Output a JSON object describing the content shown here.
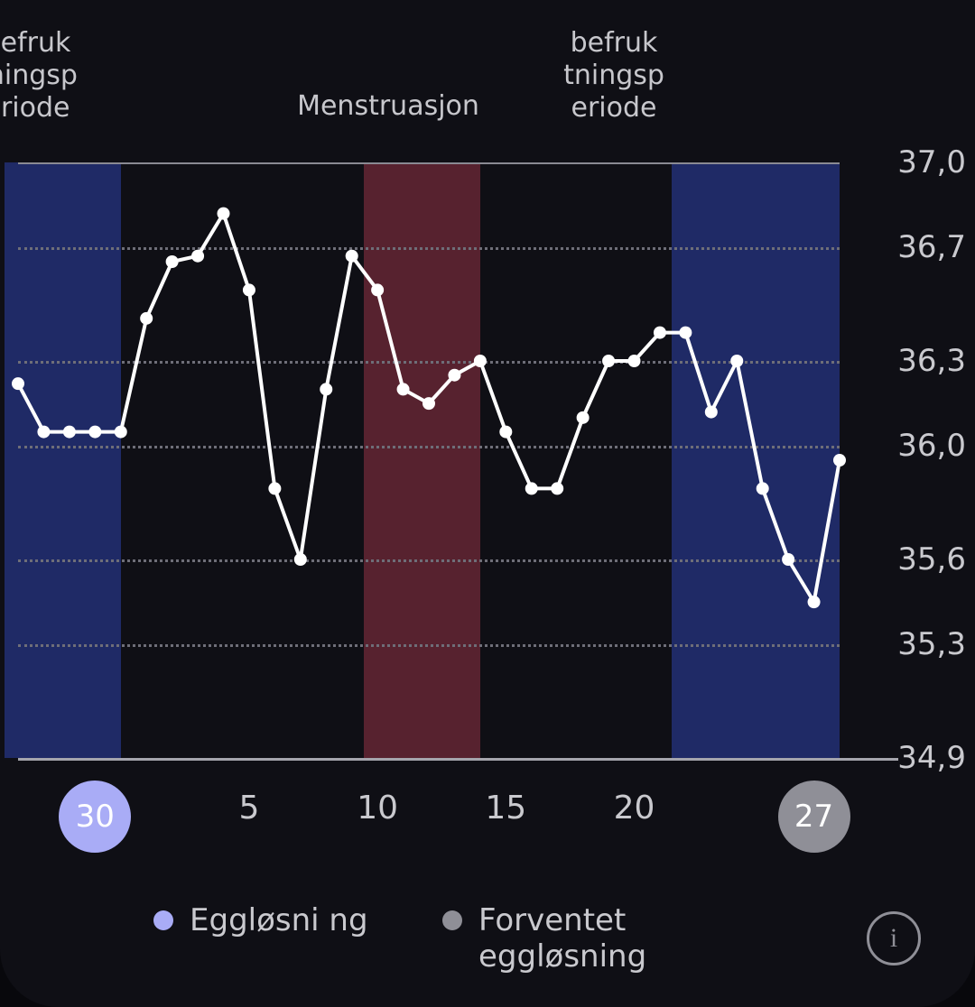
{
  "colors": {
    "fertile_band": "#1f2a66",
    "menstruation_band": "#57222f",
    "ovulation_badge": "#a9acf6",
    "expected_badge": "#8f8f97",
    "line": "#ffffff"
  },
  "phases": [
    {
      "label": "befruk\ntningsp\neriode"
    },
    {
      "label": "Menstruasjon"
    },
    {
      "label": "befruk\ntningsp\neriode"
    }
  ],
  "legend": [
    {
      "label": "Eggløsni\nng",
      "kind": "ovulation"
    },
    {
      "label": "Forventet eggløsning",
      "kind": "expected"
    }
  ],
  "chart_data": {
    "type": "line",
    "title": "",
    "xlabel": "",
    "ylabel": "",
    "ylim": [
      34.9,
      37.0
    ],
    "y_ticks": [
      34.9,
      35.3,
      35.6,
      36.0,
      36.3,
      36.7,
      37.0
    ],
    "y_tick_labels": [
      "34,9",
      "35,3",
      "35,6",
      "36,0",
      "36,3",
      "36,7",
      "37,0"
    ],
    "x_range": [
      27,
      30
    ],
    "x_ticks_plain": [
      5,
      10,
      15,
      20
    ],
    "x_badges": [
      {
        "x": 30,
        "label": "30",
        "kind": "ovulation"
      },
      {
        "x": 27,
        "label": "27",
        "kind": "expected",
        "wrap": true
      }
    ],
    "bands": [
      {
        "from": 27,
        "to": 31,
        "kind": "fertile"
      },
      {
        "from": 10,
        "to": 14,
        "kind": "menstruation"
      },
      {
        "from": 22,
        "to": 28,
        "kind": "fertile",
        "wrap": true
      }
    ],
    "series": [
      {
        "name": "temperature",
        "points": [
          {
            "x": 27,
            "y": 36.22
          },
          {
            "x": 28,
            "y": 36.05
          },
          {
            "x": 29,
            "y": 36.05
          },
          {
            "x": 30,
            "y": 36.05
          },
          {
            "x": 31,
            "y": 36.05
          },
          {
            "x": 1,
            "y": 36.45
          },
          {
            "x": 2,
            "y": 36.65
          },
          {
            "x": 3,
            "y": 36.67
          },
          {
            "x": 4,
            "y": 36.82
          },
          {
            "x": 5,
            "y": 36.55
          },
          {
            "x": 6,
            "y": 35.85
          },
          {
            "x": 7,
            "y": 35.6
          },
          {
            "x": 8,
            "y": 36.2
          },
          {
            "x": 9,
            "y": 36.67
          },
          {
            "x": 10,
            "y": 36.55
          },
          {
            "x": 11,
            "y": 36.2
          },
          {
            "x": 12,
            "y": 36.15
          },
          {
            "x": 13,
            "y": 36.25
          },
          {
            "x": 14,
            "y": 36.3
          },
          {
            "x": 15,
            "y": 36.05
          },
          {
            "x": 16,
            "y": 35.85
          },
          {
            "x": 17,
            "y": 35.85
          },
          {
            "x": 18,
            "y": 36.1
          },
          {
            "x": 19,
            "y": 36.3
          },
          {
            "x": 20,
            "y": 36.3
          },
          {
            "x": 21,
            "y": 36.4
          },
          {
            "x": 22,
            "y": 36.4
          },
          {
            "x": 23,
            "y": 36.12
          },
          {
            "x": 24,
            "y": 36.3
          },
          {
            "x": 25,
            "y": 35.85
          },
          {
            "x": 26,
            "y": 35.6
          },
          {
            "x": 27,
            "y": 35.45,
            "wrap": true
          },
          {
            "x": 28,
            "y": 35.95,
            "wrap": true
          }
        ]
      }
    ]
  }
}
